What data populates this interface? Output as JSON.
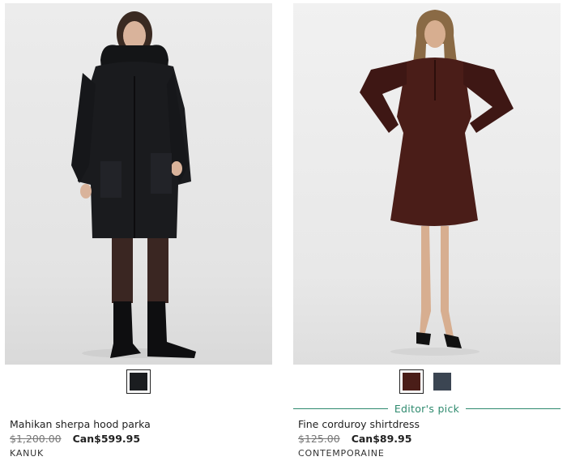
{
  "products": [
    {
      "name": "Mahikan sherpa hood parka",
      "old_price": "$1,200.00",
      "price": "Can$599.95",
      "brand": "KANUK",
      "badge": "",
      "swatches": [
        {
          "color": "#1b1d20",
          "selected": true
        }
      ]
    },
    {
      "name": "Fine corduroy shirtdress",
      "old_price": "$125.00",
      "price": "Can$89.95",
      "brand": "CONTEMPORAINE",
      "badge": "Editor's pick",
      "swatches": [
        {
          "color": "#4a1d18",
          "selected": true
        },
        {
          "color": "#3b4552",
          "selected": false
        }
      ]
    }
  ]
}
